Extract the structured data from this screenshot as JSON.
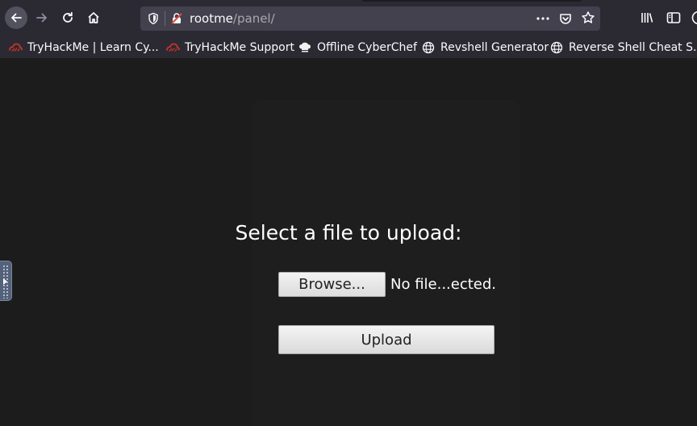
{
  "toolbar": {
    "back_icon": "arrow-left-icon",
    "forward_icon": "arrow-right-icon",
    "reload_icon": "reload-icon",
    "home_icon": "home-icon"
  },
  "urlbar": {
    "host": "rootme",
    "path": "/panel/",
    "shield_icon": "shield-icon",
    "insecure_icon": "insecure-lock-icon",
    "more_icon": "ellipsis-icon",
    "pocket_icon": "pocket-icon",
    "star_icon": "star-icon"
  },
  "bookmarks": [
    {
      "label": "TryHackMe | Learn Cy...",
      "icon": "tryhackme-icon"
    },
    {
      "label": "TryHackMe Support",
      "icon": "tryhackme-icon"
    },
    {
      "label": "Offline CyberChef",
      "icon": "chef-hat-icon"
    },
    {
      "label": "Revshell Generator",
      "icon": "globe-icon"
    },
    {
      "label": "Reverse Shell Cheat S...",
      "icon": "globe-icon"
    }
  ],
  "page": {
    "heading": "Select a file to upload:",
    "browse_label": "Browse...",
    "file_status": "No file...ected.",
    "upload_label": "Upload"
  },
  "colors": {
    "toolbar_bg": "#2b2a33",
    "urlbar_bg": "#42414d",
    "page_bg": "#1c1c1c",
    "accent_red": "#e3483a"
  }
}
